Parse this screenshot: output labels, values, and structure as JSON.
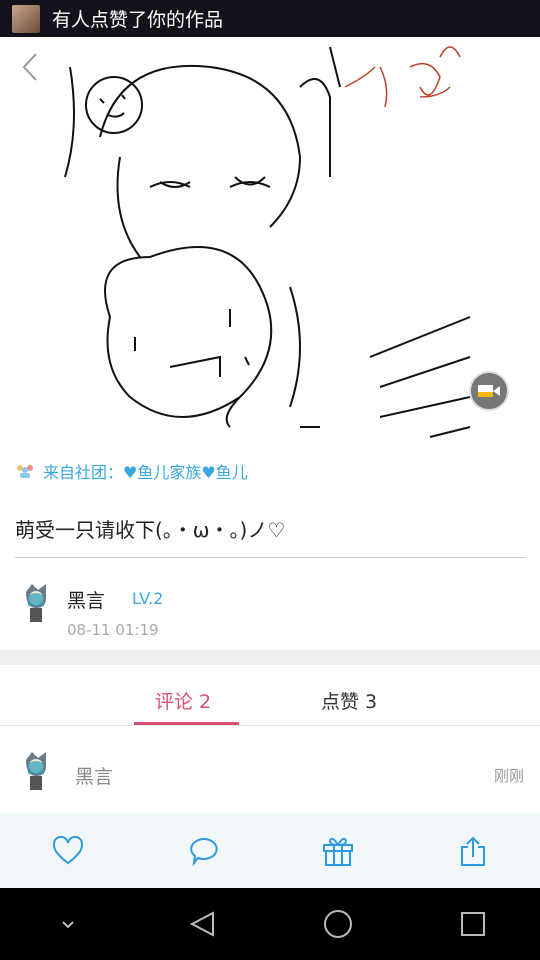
{
  "notification": {
    "title": "有人点赞了你的作品"
  },
  "post": {
    "club_prefix": "来自社团：",
    "club_name": "♥鱼儿家族♥鱼儿",
    "caption": "萌受一只请收下(。・ω・。)ノ♡",
    "author": {
      "name": "黑言",
      "level": "LV.2",
      "date": "08-11 01:19"
    }
  },
  "tabs": [
    {
      "label": "评论 2",
      "active": true
    },
    {
      "label": "点赞 3",
      "active": false
    }
  ],
  "comments": [
    {
      "name": "黑言",
      "time": "刚刚"
    }
  ],
  "colors": {
    "accent": "#d9506f",
    "link": "#3aa8e0",
    "icon": "#2e9be0"
  }
}
